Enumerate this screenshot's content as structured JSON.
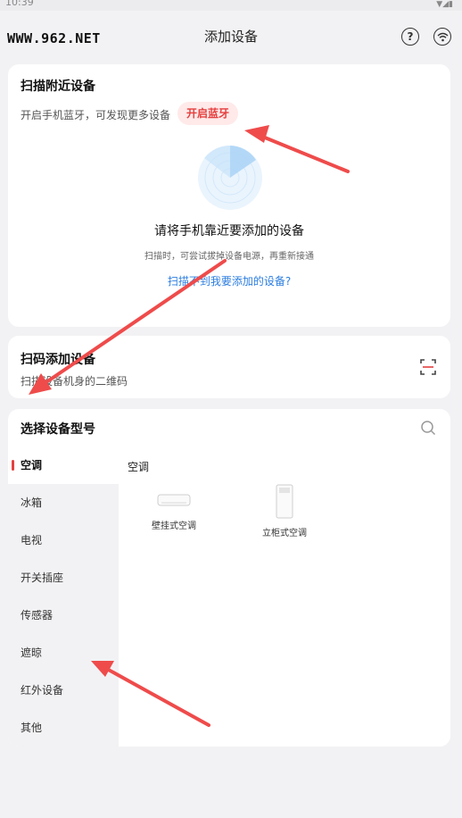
{
  "statusbar": {
    "time": "10:39",
    "signal": "▼◢▮"
  },
  "header": {
    "watermark": "WWW.962.NET",
    "title": "添加设备"
  },
  "nearby": {
    "title": "扫描附近设备",
    "subtitle": "开启手机蓝牙，可发现更多设备",
    "bluetooth_button": "开启蓝牙",
    "main_text": "请将手机靠近要添加的设备",
    "hint": "扫描时，可尝试拔掉设备电源，再重新接通",
    "link": "扫描不到我要添加的设备?"
  },
  "qr": {
    "title": "扫码添加设备",
    "subtitle": "扫描设备机身的二维码"
  },
  "model": {
    "title": "选择设备型号",
    "categories": [
      {
        "label": "空调"
      },
      {
        "label": "冰箱"
      },
      {
        "label": "电视"
      },
      {
        "label": "开关插座"
      },
      {
        "label": "传感器"
      },
      {
        "label": "遮晾"
      },
      {
        "label": "红外设备"
      },
      {
        "label": "其他"
      }
    ],
    "category_title": "空调",
    "devices": [
      {
        "name": "壁挂式空调"
      },
      {
        "name": "立柜式空调"
      }
    ]
  },
  "colors": {
    "accent_red": "#e4403f",
    "link_blue": "#2b7de0",
    "background": "#f2f2f4"
  }
}
